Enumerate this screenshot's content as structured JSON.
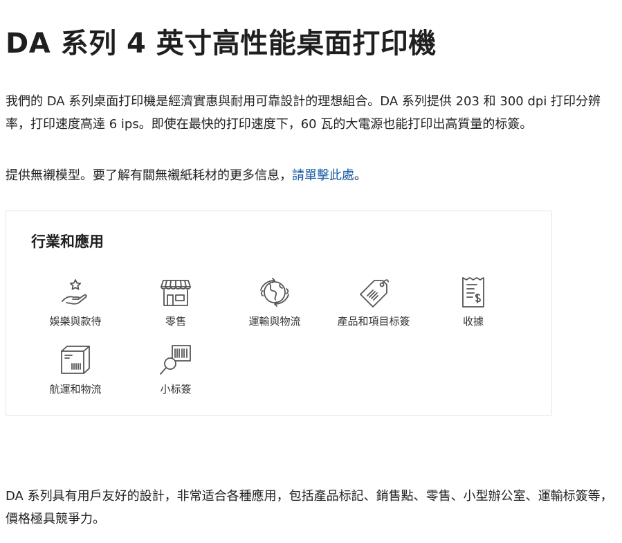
{
  "page": {
    "title": "DA 系列 4 英寸高性能桌面打印機",
    "intro": "我們的 DA 系列桌面打印機是經濟實惠與耐用可靠設計的理想組合。DA 系列提供 203 和 300 dpi 打印分辨率，打印速度高達 6 ips。即使在最快的打印速度下，60 瓦的大電源也能打印出高質量的标簽。",
    "note_prefix": "提供無襯模型。要了解有關無襯紙耗材的更多信息，",
    "note_link": "請單擊此處",
    "note_suffix": "。",
    "outro": "DA 系列具有用戶友好的設計，非常适合各種應用，包括產品标記、銷售點、零售、小型辦公室、運輸标簽等，價格極具競爭力。"
  },
  "industries": {
    "title": "行業和應用",
    "items": [
      {
        "label": "娛樂與款待",
        "icon": "hand-star-icon"
      },
      {
        "label": "零售",
        "icon": "storefront-icon"
      },
      {
        "label": "運輸與物流",
        "icon": "globe-arrows-icon"
      },
      {
        "label": "產品和項目标簽",
        "icon": "tag-icon"
      },
      {
        "label": "收據",
        "icon": "receipt-icon"
      },
      {
        "label": "航運和物流",
        "icon": "package-box-icon"
      },
      {
        "label": "小标簽",
        "icon": "barcode-magnifier-icon"
      }
    ]
  }
}
